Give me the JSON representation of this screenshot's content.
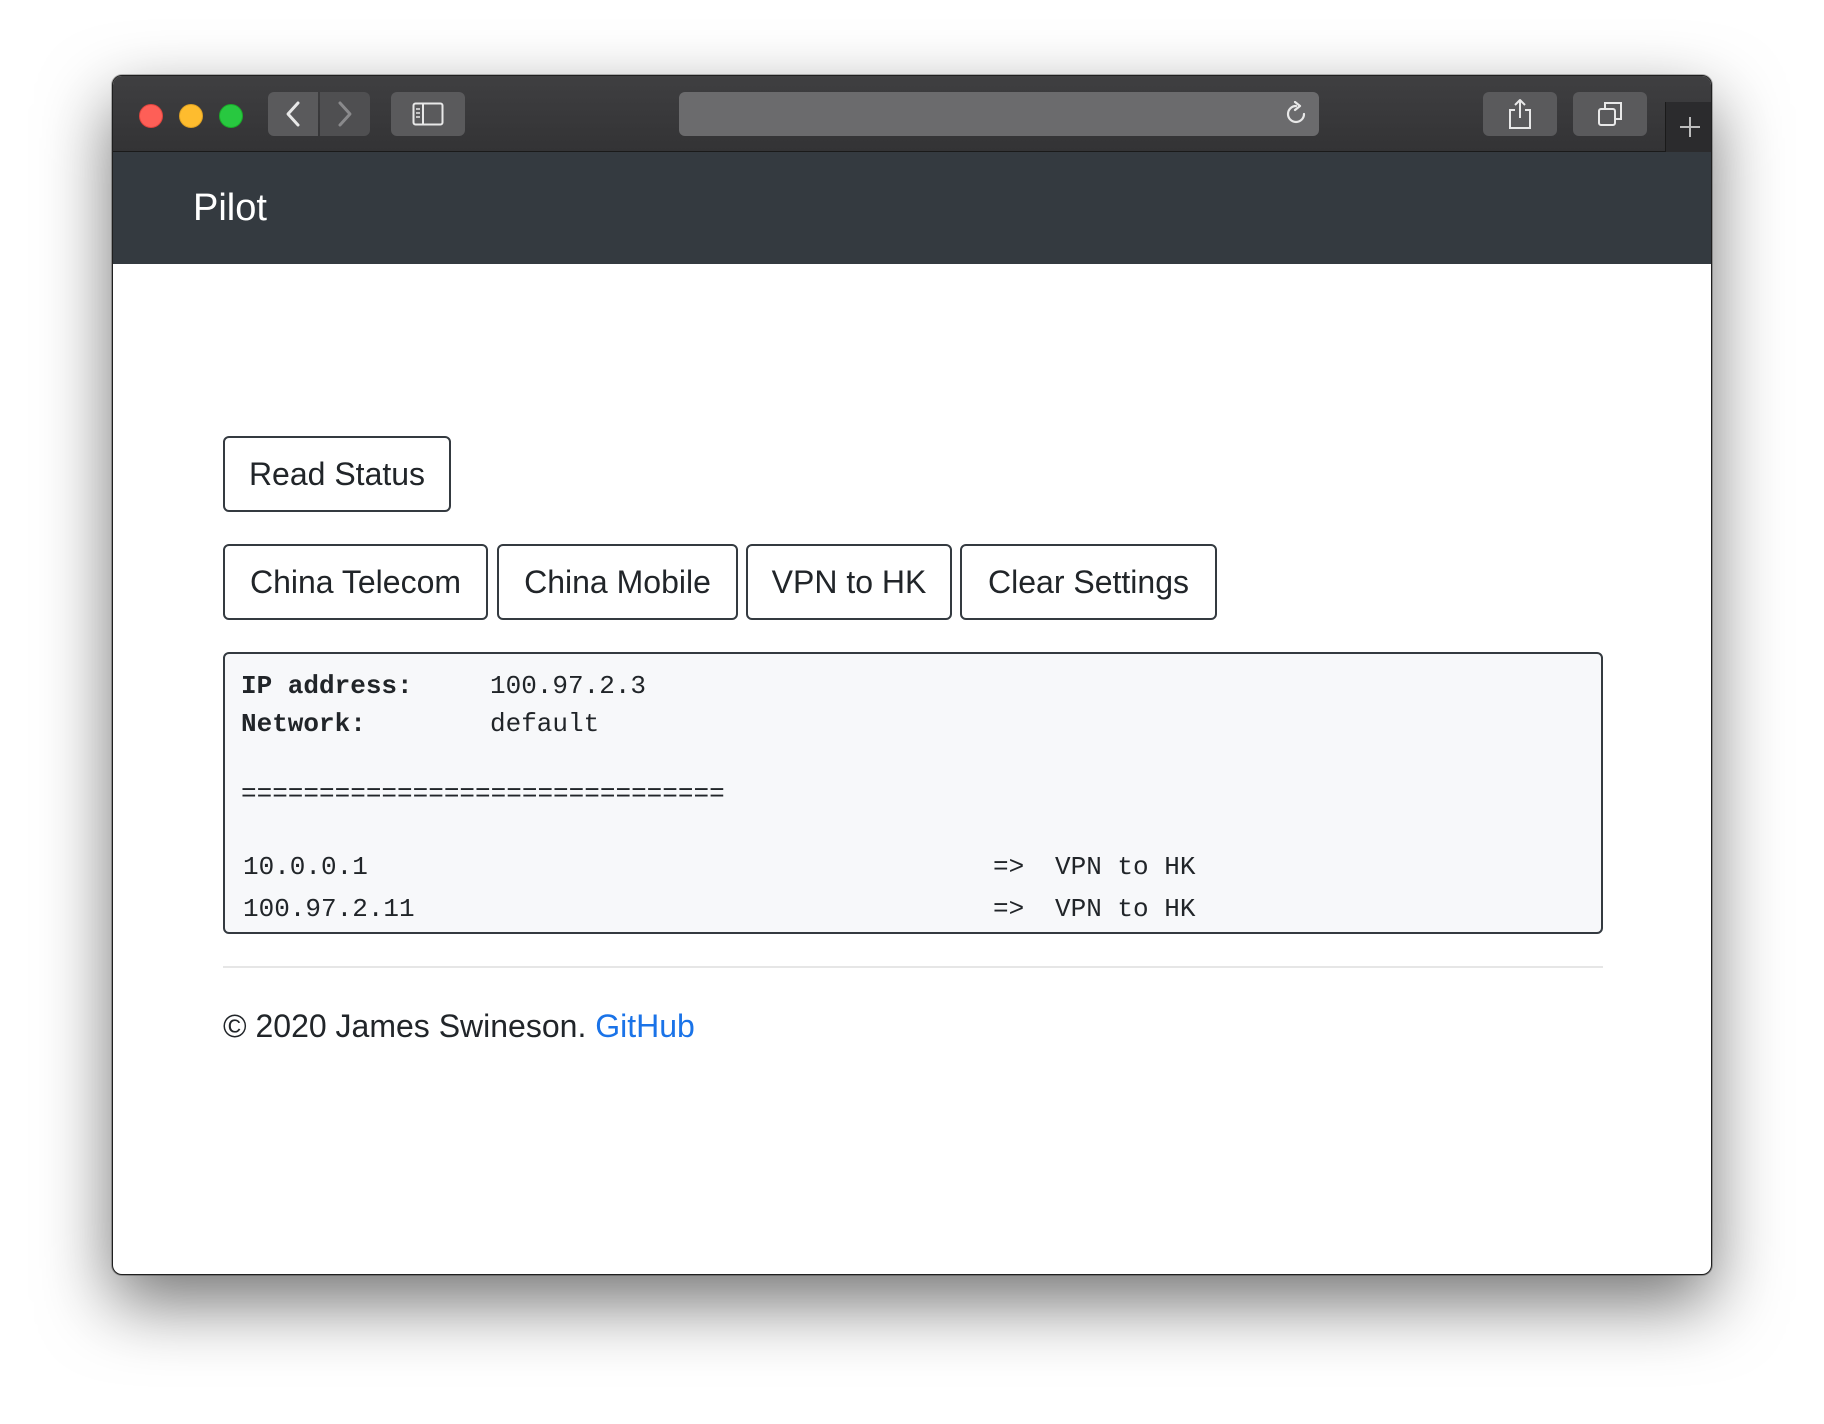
{
  "browser": {
    "url_value": "",
    "icons": {
      "back": "chevron-left-icon",
      "forward": "chevron-right-icon",
      "sidebar": "sidebar-icon",
      "reload": "reload-icon",
      "share": "share-icon",
      "tabs": "tabs-overview-icon",
      "new_tab": "plus-icon"
    }
  },
  "navbar": {
    "brand": "Pilot",
    "background": "#343a40"
  },
  "actions": {
    "read_status": "Read Status",
    "network_buttons": [
      "China Telecom",
      "China Mobile",
      "VPN to HK",
      "Clear Settings"
    ]
  },
  "status": {
    "ip_label": "IP address:",
    "ip_value": "100.97.2.3",
    "network_label": "Network:",
    "network_value": "default",
    "separator": "===============================",
    "routes": [
      {
        "ip": "10.0.0.1",
        "arrow": "=>",
        "target": "VPN to HK"
      },
      {
        "ip": "100.97.2.11",
        "arrow": "=>",
        "target": "VPN to HK"
      }
    ]
  },
  "footer": {
    "copyright": "© 2020 James Swineson. ",
    "link_label": "GitHub",
    "link_color": "#1a73e8"
  }
}
